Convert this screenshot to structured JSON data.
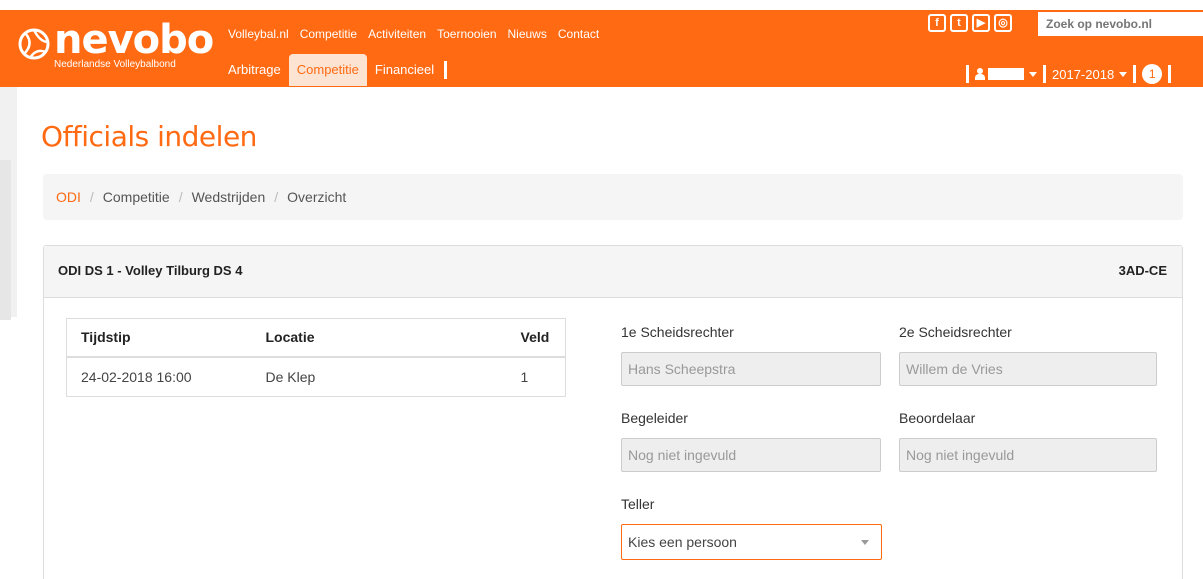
{
  "brand": {
    "name": "nevobo",
    "subtitle": "Nederlandse Volleybalbond",
    "color": "#ff6a13"
  },
  "top_nav": [
    "Volleybal.nl",
    "Competitie",
    "Activiteiten",
    "Toernooien",
    "Nieuws",
    "Contact"
  ],
  "sub_nav": {
    "items": [
      "Arbitrage",
      "Competitie",
      "Financieel"
    ],
    "active": "Competitie"
  },
  "social": [
    "facebook-icon",
    "twitter-icon",
    "youtube-icon",
    "instagram-icon"
  ],
  "search": {
    "placeholder": "Zoek op nevobo.nl"
  },
  "user": {
    "season": "2017-2018",
    "notifications": "1"
  },
  "page": {
    "title": "Officials indelen"
  },
  "breadcrumb": [
    "ODI",
    "Competitie",
    "Wedstrijden",
    "Overzicht"
  ],
  "match": {
    "title": "ODI DS 1 - Volley Tilburg DS 4",
    "code": "3AD-CE",
    "table": {
      "headers": [
        "Tijdstip",
        "Locatie",
        "Veld"
      ],
      "rows": [
        [
          "24-02-2018 16:00",
          "De Klep",
          "1"
        ]
      ]
    },
    "officials": {
      "ref1": {
        "label": "1e Scheidsrechter",
        "value": "Hans Scheepstra"
      },
      "ref2": {
        "label": "2e Scheidsrechter",
        "value": "Willem de Vries"
      },
      "guide": {
        "label": "Begeleider",
        "value": "Nog niet ingevuld"
      },
      "assessor": {
        "label": "Beoordelaar",
        "value": "Nog niet ingevuld"
      },
      "counter": {
        "label": "Teller",
        "value": "Kies een persoon"
      }
    }
  }
}
